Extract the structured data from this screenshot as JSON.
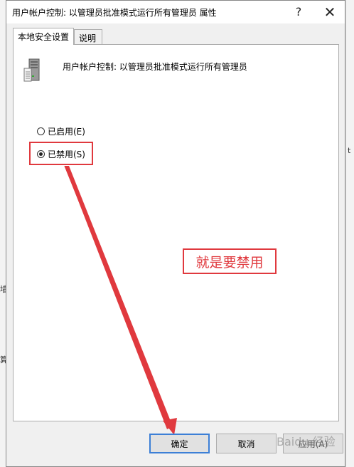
{
  "window": {
    "title": "用户帐户控制: 以管理员批准模式运行所有管理员 属性",
    "help_glyph": "?",
    "close_glyph": "✕"
  },
  "tabs": [
    {
      "label": "本地安全设置",
      "active": true
    },
    {
      "label": "说明",
      "active": false
    }
  ],
  "policy": {
    "name": "用户帐户控制: 以管理员批准模式运行所有管理员",
    "icon": "server-icon"
  },
  "options": {
    "enabled_label": "已启用(E)",
    "disabled_label": "已禁用(S)",
    "selected": "disabled"
  },
  "annotation": {
    "text": "就是要禁用",
    "color": "#e0393e"
  },
  "buttons": {
    "ok_label": "确定",
    "cancel_label": "取消",
    "apply_label": "应用(A)"
  },
  "watermark": "Baidu 经验",
  "background_fragments": {
    "right_t": "t",
    "left_1": "墙",
    "left_2": "算"
  }
}
